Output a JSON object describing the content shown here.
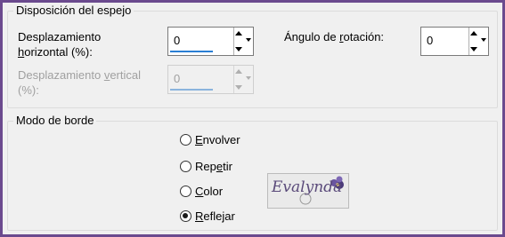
{
  "mirror_group": {
    "title": "Disposición del espejo",
    "horizontal_label_line1": "Desplazamiento",
    "horizontal_label_line2_pre": "",
    "horizontal_label_line2_u": "h",
    "horizontal_label_line2_post": "orizontal (%):",
    "horizontal_value": "0",
    "vertical_label_line1": "Desplazamiento ",
    "vertical_label_u": "v",
    "vertical_label_post": "ertical",
    "vertical_label_line2": "(%):",
    "vertical_value": "0",
    "rotation_label_pre": "Ángulo de ",
    "rotation_label_u": "r",
    "rotation_label_post": "otación:",
    "rotation_value": "0"
  },
  "border_group": {
    "title": "Modo de borde",
    "options": [
      {
        "u": "E",
        "rest": "nvolver",
        "selected": false
      },
      {
        "pre": "Rep",
        "u": "e",
        "rest": "tir",
        "selected": false
      },
      {
        "u": "C",
        "rest": "olor",
        "selected": false
      },
      {
        "u": "R",
        "rest": "eflejar",
        "selected": true
      }
    ]
  },
  "watermark": {
    "text": "Evalynda"
  },
  "colors": {
    "frame": "#6b4a8e",
    "panel": "#f0f0f0",
    "accent": "#2a7fd4"
  }
}
